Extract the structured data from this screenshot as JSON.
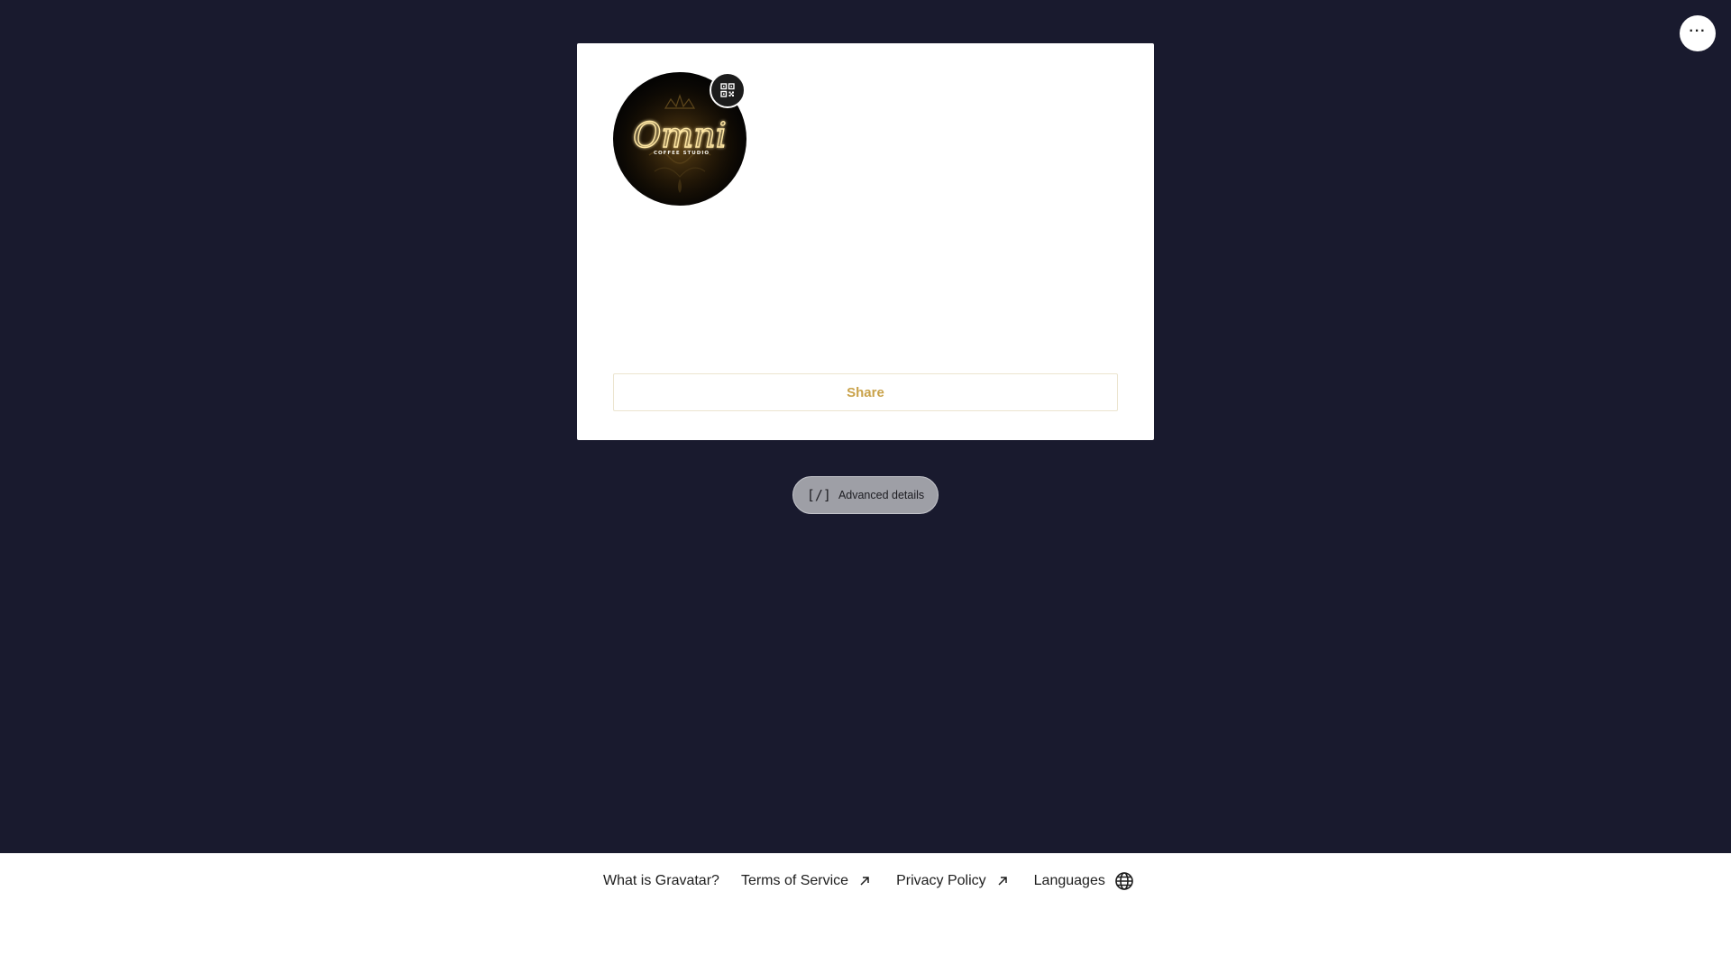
{
  "header": {
    "more_icon": "more-horizontal-icon",
    "more_label": "···"
  },
  "profile": {
    "avatar_logo": {
      "script_text": "Omni",
      "sub_text": "COFFEE STUDIO"
    },
    "qr_icon": "qr-code-icon",
    "share_label": "Share"
  },
  "advanced": {
    "icon_text": "[/]",
    "label": "Advanced details"
  },
  "footer": {
    "links": [
      {
        "label": "What is Gravatar?",
        "icon": ""
      },
      {
        "label": "Terms of Service",
        "icon": "external-arrow-icon"
      },
      {
        "label": "Privacy Policy",
        "icon": "external-arrow-icon"
      },
      {
        "label": "Languages",
        "icon": "globe-icon"
      }
    ]
  },
  "colors": {
    "background": "#191a2e",
    "card": "#ffffff",
    "accent_gold": "#c9a24a",
    "pill": "#9e9fa6",
    "text_dark": "#1d1d1d"
  }
}
